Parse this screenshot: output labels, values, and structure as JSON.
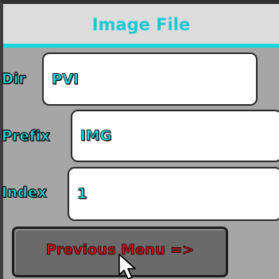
{
  "header": {
    "title": "Image File"
  },
  "fields": [
    {
      "label": "Dir",
      "value": "PVI"
    },
    {
      "label": "Prefix",
      "value": "IMG"
    },
    {
      "label": "Index",
      "value": "1"
    }
  ],
  "buttons": {
    "previous_menu": "Previous Menu =>"
  },
  "colors": {
    "accent": "#1fe2ec",
    "header_bg": "#dcdcdc",
    "panel_bg": "#a6a6a6",
    "button_bg": "#6a6a6a",
    "button_text": "#d4101a"
  },
  "cursor": {
    "icon": "mouse-pointer-icon"
  }
}
